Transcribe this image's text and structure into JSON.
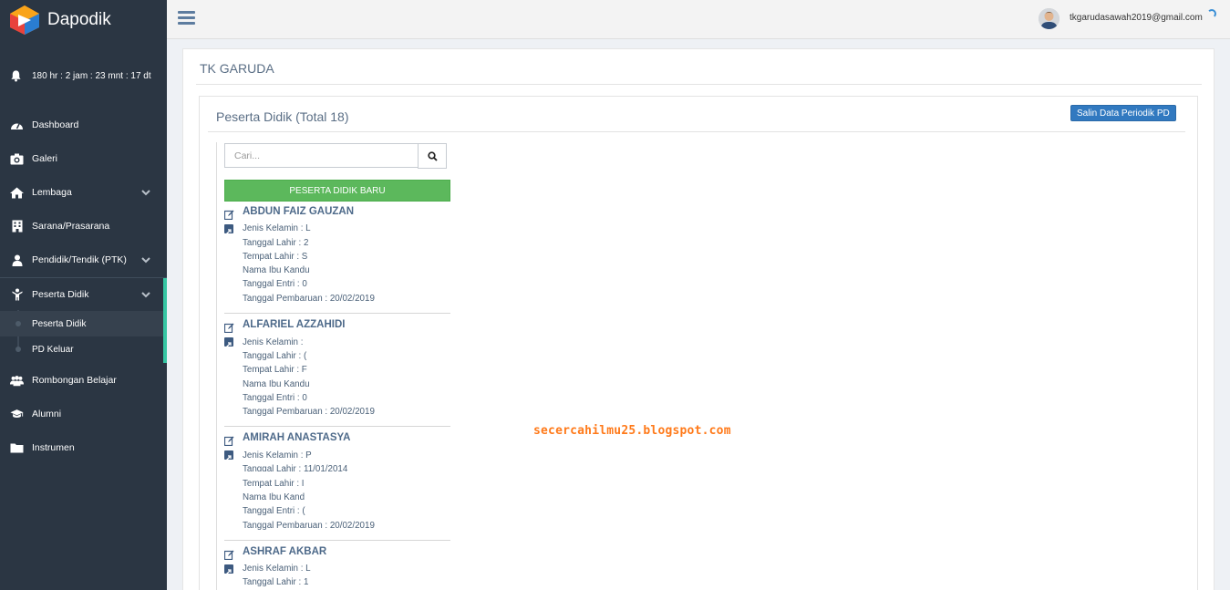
{
  "app": {
    "name": "Dapodik"
  },
  "sidebar": {
    "countdown": "180 hr : 2 jam : 23 mnt : 17 dt",
    "items": [
      {
        "label": "Dashboard",
        "icon": "dashboard-icon"
      },
      {
        "label": "Galeri",
        "icon": "camera-icon"
      },
      {
        "label": "Lembaga",
        "icon": "home-icon"
      },
      {
        "label": "Sarana/Prasarana",
        "icon": "building-icon"
      },
      {
        "label": "Pendidik/Tendik (PTK)",
        "icon": "user-icon"
      },
      {
        "label": "Peserta Didik",
        "icon": "child-icon"
      },
      {
        "label": "Rombongan Belajar",
        "icon": "users-icon"
      },
      {
        "label": "Alumni",
        "icon": "graduation-cap-icon"
      },
      {
        "label": "Instrumen",
        "icon": "folder-icon"
      }
    ],
    "sub_items": [
      {
        "label": "Peserta Didik"
      },
      {
        "label": "PD Keluar"
      }
    ],
    "accent_color": "#36c6a3"
  },
  "topbar": {
    "user_email": "tkgarudasawah2019@gmail.com"
  },
  "main": {
    "school_name": "TK GARUDA",
    "section_title": "Peserta Didik (Total 18)",
    "salin_button": "Salin Data Periodik PD",
    "search_placeholder": "Cari...",
    "new_button": "PESERTA DIDIK BARU",
    "students": [
      {
        "name": "ABDUN FAIZ GAUZAN",
        "jenis_kelamin": "Jenis Kelamin : L",
        "tanggal_lahir": "Tanggal Lahir : 2",
        "tempat_lahir": "Tempat Lahir : S",
        "nama_ibu": "Nama Ibu Kandu",
        "tanggal_entri": "Tanggal Entri : 0",
        "tanggal_pembaruan": "Tanggal Pembaruan : 20/02/2019"
      },
      {
        "name": "ALFARIEL AZZAHIDI",
        "jenis_kelamin": "Jenis Kelamin : ",
        "tanggal_lahir": "Tanggal Lahir : (",
        "tempat_lahir": "Tempat Lahir : F",
        "nama_ibu": "Nama Ibu Kandu",
        "tanggal_entri": "Tanggal Entri : 0",
        "tanggal_pembaruan": "Tanggal Pembaruan : 20/02/2019"
      },
      {
        "name": "AMIRAH ANASTASYA",
        "jenis_kelamin": "Jenis Kelamin : P",
        "tanggal_lahir": "Tanggal Lahir : 11/01/2014",
        "tempat_lahir": "Tempat Lahir : I",
        "nama_ibu": "Nama Ibu Kand",
        "tanggal_entri": "Tanggal Entri : (",
        "tanggal_pembaruan": "Tanggal Pembaruan : 20/02/2019"
      },
      {
        "name": "ASHRAF AKBAR",
        "jenis_kelamin": "Jenis Kelamin : L",
        "tanggal_lahir": "Tanggal Lahir : 1"
      }
    ]
  },
  "watermark": "secercahilmu25.blogspot.com"
}
